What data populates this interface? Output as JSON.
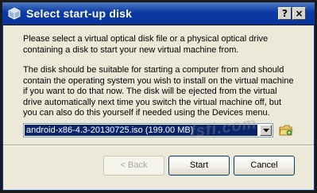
{
  "window": {
    "title": "Select start-up disk",
    "help_label": "?",
    "close_label": "×"
  },
  "body": {
    "paragraph1": "Please select a virtual optical disk file or a physical optical drive containing a disk to start your new virtual machine from.",
    "paragraph2": "The disk should be suitable for starting a computer from and should contain the operating system you wish to install on the virtual machine if you want to do that now. The disk will be ejected from the virtual drive automatically next time you switch the virtual machine off, but you can also do this yourself if needed using the Devices menu."
  },
  "disk_selector": {
    "selected_value": "android-x86-4.3-20130725.iso (199.00 MB)"
  },
  "buttons": {
    "back_label": "< Back",
    "start_label": "Start",
    "cancel_label": "Cancel"
  },
  "watermark": "fsfi.com",
  "colors": {
    "titlebar": "#0b3ba6",
    "selection": "#0a246a",
    "dialog_bg": "#ece9d8"
  }
}
